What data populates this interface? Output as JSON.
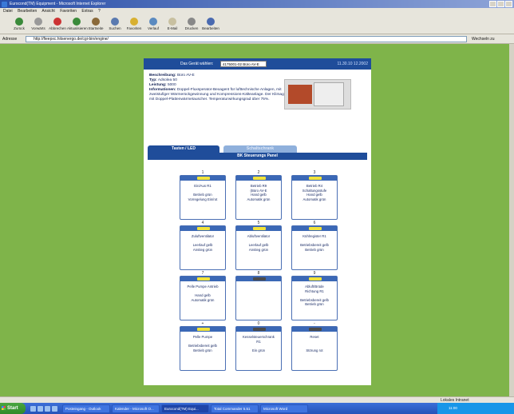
{
  "window": {
    "title": "Eurocond(TM) Equipment - Microsoft Internet Explorer"
  },
  "menu": [
    "Datei",
    "Bearbeiten",
    "Ansicht",
    "Favoriten",
    "Extras",
    "?"
  ],
  "toolbar": [
    "Zurück",
    "Vorwärts",
    "Abbrechen",
    "Aktualisieren",
    "Startseite",
    "Suchen",
    "Favoriten",
    "Verlauf",
    "E-Mail",
    "Drucken",
    "Bearbeiten"
  ],
  "address": {
    "label": "Adresse",
    "value": "http://fieepxc.hitsenergo.de/cgi-bin/engine/",
    "go": "Wechseln zu",
    "links": "Links"
  },
  "page": {
    "select_label": "Das Gerät wählen:",
    "select_value": "4175001-02 Büro AV-E",
    "date": "11.30.10 12.2002",
    "info": {
      "desc_k": "Beschreibung:",
      "desc_v": "Büro AV-E",
      "type_k": "Typ:",
      "type_v": "Adsolea 50",
      "power_k": "Leistung:",
      "power_v": "5000",
      "info_k": "Informationen:",
      "info_v": "Doppel-Fluxsperator-Bexagent für lufttechnische Anlagen, mit zweistufiger Wärmerückgewinnung und Kompressions-Kälteanlage. Der Klimagerät mit Doppel-Plattenwärmetauscher. Temperaturwirkungsgrad über 75%."
    },
    "tabs": [
      "Tasten / LED",
      "Schaltschrank"
    ],
    "panel_title": "BK Steuerungs Panel",
    "buttons": [
      {
        "n": "1",
        "led": "#f2e33a",
        "lines": [
          "Ein/Aus R1",
          "",
          "Betrieb grün",
          "Vorregelung Ein/rot"
        ]
      },
      {
        "n": "2",
        "led": "#f2e33a",
        "lines": [
          "Betrieb R9",
          "(Büro AV-E",
          "Hand gelb",
          "Automatik grün"
        ]
      },
      {
        "n": "3",
        "led": "#f2e33a",
        "lines": [
          "Betrieb R4",
          "Schaltungsstufe",
          "Hand gelb",
          "Automatik grün"
        ]
      },
      {
        "n": "4",
        "led": "#f2e33a",
        "lines": [
          "Zuluftventilator",
          "",
          "Leerlauf gelb",
          "Anstieg grün"
        ]
      },
      {
        "n": "5",
        "led": "#f2e33a",
        "lines": [
          "Abluftventilator",
          "",
          "Leerlauf gelb",
          "Anstieg grün"
        ]
      },
      {
        "n": "6",
        "led": "#f2e33a",
        "lines": [
          "Kühlregister R1",
          "",
          "Betriebsbereit gelb",
          "Betrieb grün"
        ]
      },
      {
        "n": "7",
        "led": "#f2e33a",
        "lines": [
          "Pelle Pumpe Antrieb",
          "",
          "Hand gelb",
          "Automatik grün"
        ]
      },
      {
        "n": "8",
        "led": "#4b4b4b",
        "lines": [
          "",
          "",
          "",
          ""
        ]
      },
      {
        "n": "9",
        "led": "#f2e33a",
        "lines": [
          "Abluft/Brüde",
          "Richtung R1",
          "",
          "Betriebsbereit gelb",
          "Betrieb grün"
        ]
      },
      {
        "n": "+",
        "led": "#f2e33a",
        "lines": [
          "Pelle Pumpe",
          "",
          "Betriebsbereit gelb",
          "Betrieb grün"
        ]
      },
      {
        "n": "0",
        "led": "#4b4b4b",
        "lines": [
          "Kesselsteuerschrank",
          "R1",
          "",
          "Ein grün"
        ]
      },
      {
        "n": "-",
        "led": "#4b4b4b",
        "lines": [
          "Reset",
          "",
          "",
          "Störung rot"
        ]
      }
    ]
  },
  "status": {
    "zone": "Lokales Intranet"
  },
  "taskbar": {
    "start": "Start",
    "tasks": [
      "Posteingang - Outlook",
      "Kalender - Microsoft O...",
      "Eurocond(TM) Equi...",
      "Total Commander 5.51",
      "Microsoft Word"
    ],
    "clock": "11:00"
  }
}
